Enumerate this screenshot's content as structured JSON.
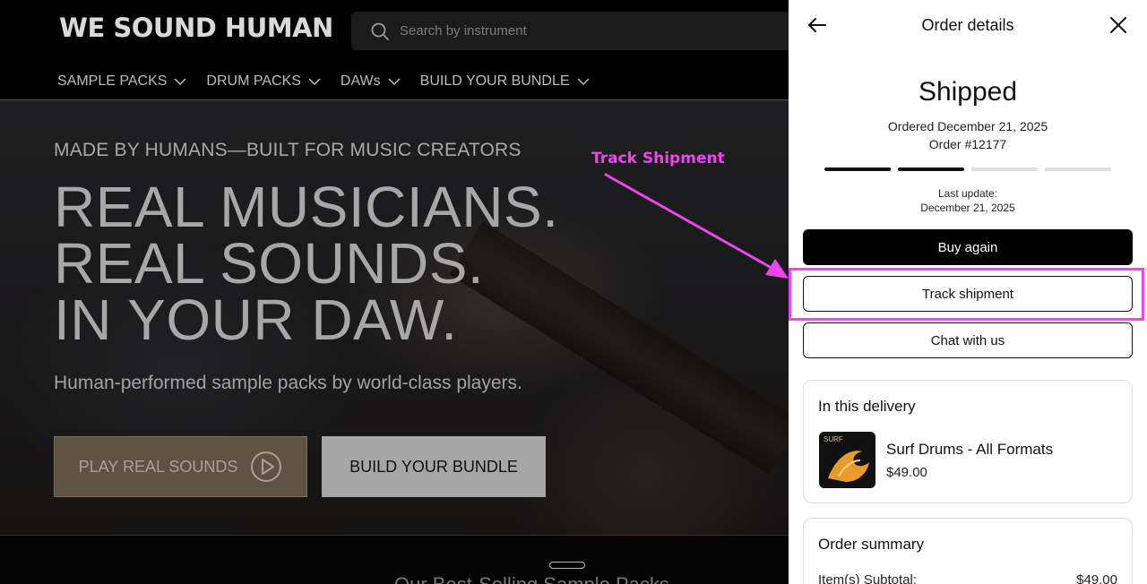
{
  "site": {
    "logo": "WE SOUND HUMAN",
    "search_placeholder": "Search by instrument",
    "nav": [
      {
        "label": "SAMPLE PACKS"
      },
      {
        "label": "DRUM PACKS"
      },
      {
        "label": "DAWs"
      },
      {
        "label": "BUILD YOUR BUNDLE"
      }
    ],
    "hero": {
      "eyebrow": "MADE BY HUMANS—BUILT FOR MUSIC CREATORS",
      "headline_lines": [
        "REAL MUSICIANS.",
        "REAL SOUNDS.",
        "IN YOUR DAW."
      ],
      "subtitle": "Human-performed sample packs by world-class players.",
      "play_button": "PLAY REAL SOUNDS",
      "bundle_button": "BUILD YOUR BUNDLE"
    },
    "next_section_title_peek": "Our Best-Selling Sample Packs"
  },
  "drawer": {
    "title": "Order details",
    "status": "Shipped",
    "ordered": "Ordered December 21, 2025",
    "order_number": "Order #12177",
    "progress": {
      "completed_steps": 2,
      "total_steps": 4
    },
    "last_update_label": "Last update:",
    "last_update_date": "December 21, 2025",
    "buttons": {
      "buy_again": "Buy again",
      "track_shipment": "Track shipment",
      "chat": "Chat with us"
    },
    "delivery": {
      "title": "In this delivery",
      "item": {
        "thumb_label": "SURF",
        "name": "Surf Drums - All Formats",
        "price": "$49.00"
      }
    },
    "summary": {
      "title": "Order summary",
      "subtotal_label": "Item(s) Subtotal:",
      "subtotal_value": "$49.00"
    }
  },
  "annotation": {
    "label": "Track Shipment",
    "color": "#ef45ef"
  },
  "colors": {
    "accent_play_button": "#5e5244",
    "primary_button": "#000000",
    "annotation": "#ef45ef"
  }
}
